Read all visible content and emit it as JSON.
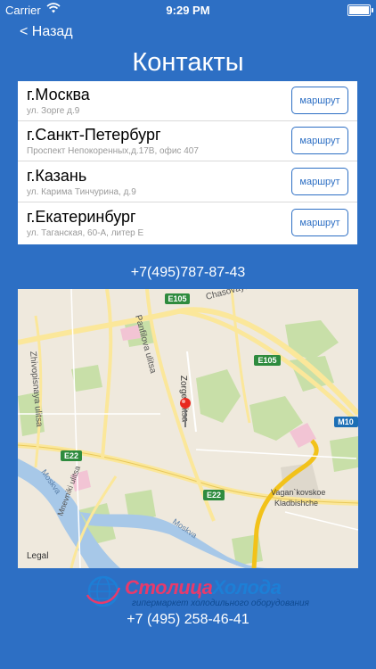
{
  "status_bar": {
    "carrier": "Carrier",
    "time": "9:29 PM"
  },
  "nav": {
    "back_label": "< Назад",
    "title": "Контакты"
  },
  "offices": [
    {
      "city": "г.Москва",
      "address": "ул. Зорге д.9",
      "button": "маршрут"
    },
    {
      "city": "г.Санкт-Петербург",
      "address": "Проспект Непокоренных,д.17В, офис 407",
      "button": "маршрут"
    },
    {
      "city": "г.Казань",
      "address": "ул. Карима Тинчурина, д.9",
      "button": "маршрут"
    },
    {
      "city": "г.Екатеринбург",
      "address": "ул. Таганская, 60-А, литер Е",
      "button": "маршрут"
    }
  ],
  "phone_main": "+7(495)787-87-43",
  "map": {
    "streets": {
      "chasovaya": "Chasovaya ulitsa",
      "panfilova": "Panfilova ulitsa",
      "zhivopisnaya": "Zhivopisnaya ulitsa",
      "zorge": "Zorge ulitsa",
      "moskva_1": "Moskva",
      "moskva_2": "Moskva",
      "mnevniki": "Mnevniki ulitsa",
      "vagan_1": "Vagan`kovskoe",
      "vagan_2": "Kladbishche"
    },
    "shields": {
      "e105_top": "E105",
      "e105_right": "E105",
      "m10": "M10",
      "e22_left": "E22",
      "e22_mid": "E22"
    },
    "legal": "Legal",
    "colors": {
      "land": "#efe9dd",
      "park": "#c8dfa8",
      "water": "#a7c8e8",
      "highway": "#f2c21a",
      "road": "#fbe79a",
      "pin": "#e8281f",
      "shield": "#2e8b3e"
    }
  },
  "logo": {
    "brand_part1": "Столица",
    "brand_part2": "Холода",
    "tagline": "гипермаркет холодильного оборудования"
  },
  "phone_footer": "+7 (495) 258-46-41"
}
